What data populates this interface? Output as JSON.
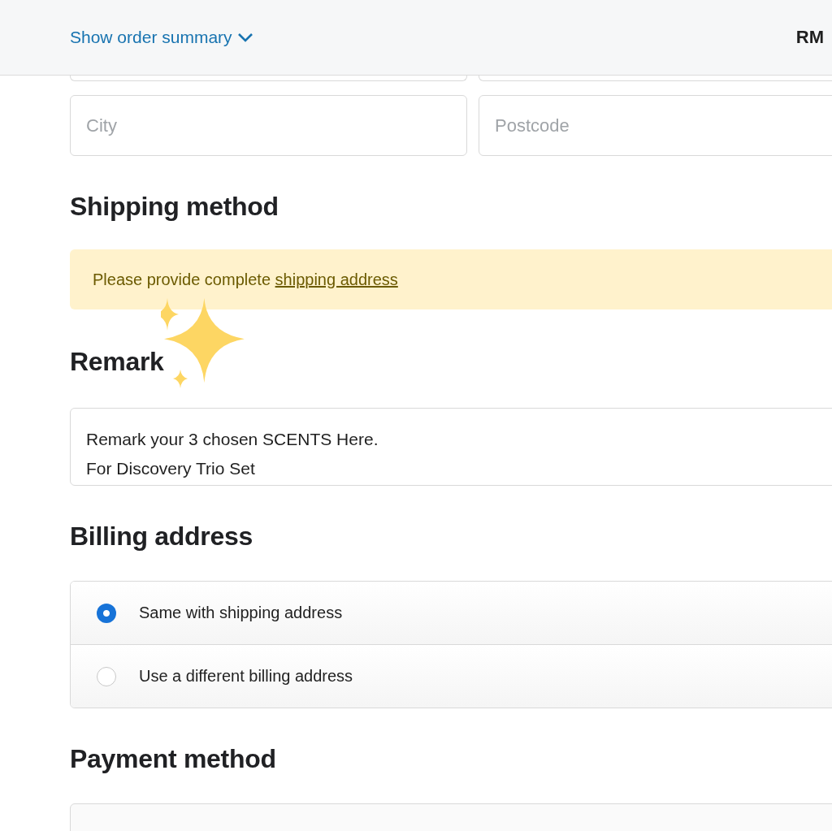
{
  "header": {
    "summary_link": "Show order summary",
    "total": "RM"
  },
  "address_fields": [
    {
      "placeholder": "City"
    },
    {
      "placeholder": "Postcode"
    }
  ],
  "shipping": {
    "title": "Shipping method",
    "notice": "Please provide complete ",
    "notice_link": "shipping address"
  },
  "remark": {
    "title": "Remark",
    "value": "Remark your 3 chosen SCENTS Here.\nFor Discovery Trio Set"
  },
  "billing": {
    "title": "Billing address",
    "options": [
      {
        "label": "Same with shipping address",
        "selected": true
      },
      {
        "label": "Use a different billing address",
        "selected": false
      }
    ]
  },
  "payment": {
    "title": "Payment method"
  }
}
